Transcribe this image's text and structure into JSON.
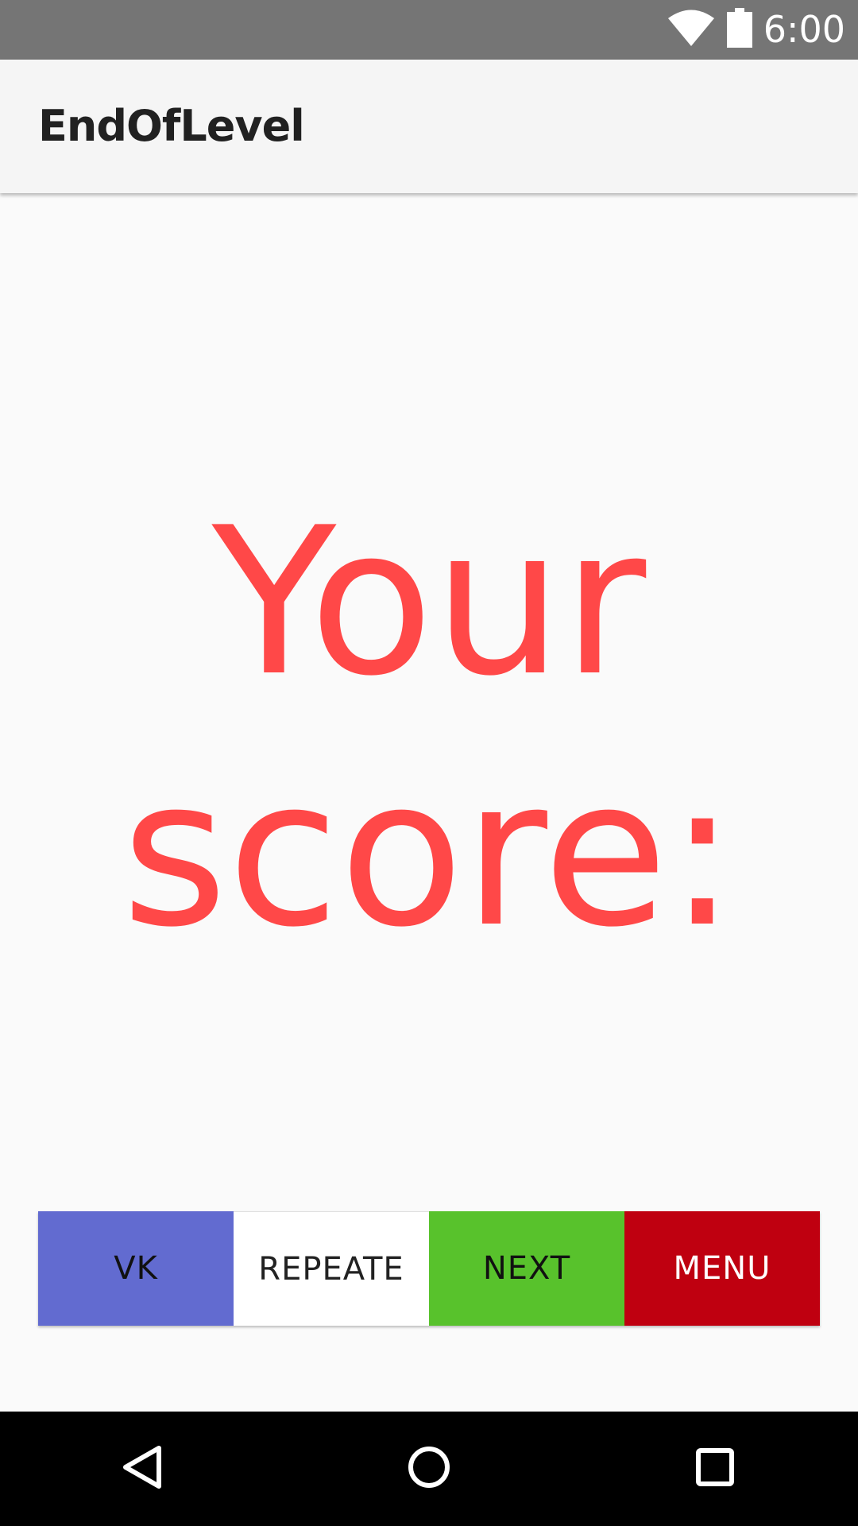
{
  "status_bar": {
    "time": "6:00",
    "icons": [
      "wifi-icon",
      "battery-icon"
    ],
    "background": "#757575"
  },
  "app_bar": {
    "title": "EndOfLevel"
  },
  "main": {
    "score_label": "Your\nscore:",
    "score_color": "#ff4848"
  },
  "buttons": {
    "vk": {
      "label": "VK",
      "color": "#626bd0"
    },
    "repeat": {
      "label": "REPEATE",
      "color": "#ffffff"
    },
    "next": {
      "label": "NEXT",
      "color": "#58c22c"
    },
    "menu": {
      "label": "MENU",
      "color": "#bf0010"
    }
  },
  "nav_bar": {
    "icons": [
      "back-icon",
      "home-icon",
      "recents-icon"
    ]
  }
}
